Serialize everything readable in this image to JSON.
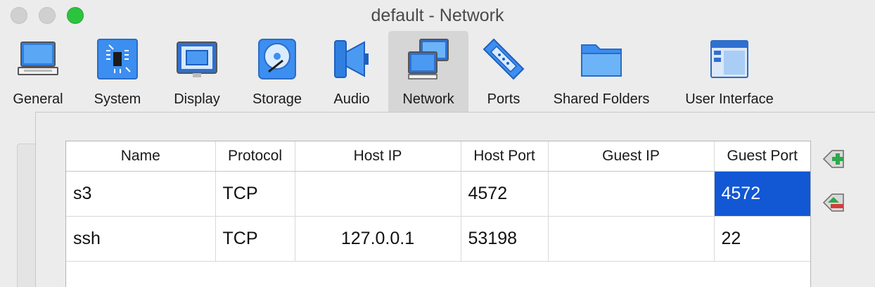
{
  "window": {
    "title": "default - Network"
  },
  "toolbar": {
    "items": [
      {
        "label": "General",
        "icon": "general-icon"
      },
      {
        "label": "System",
        "icon": "system-chip-icon"
      },
      {
        "label": "Display",
        "icon": "display-monitor-icon"
      },
      {
        "label": "Storage",
        "icon": "storage-disk-icon"
      },
      {
        "label": "Audio",
        "icon": "audio-speaker-icon"
      },
      {
        "label": "Network",
        "icon": "network-icon",
        "selected": true
      },
      {
        "label": "Ports",
        "icon": "ports-connector-icon"
      },
      {
        "label": "Shared Folders",
        "icon": "shared-folder-icon"
      },
      {
        "label": "User Interface",
        "icon": "user-interface-icon"
      }
    ]
  },
  "port_table": {
    "columns": [
      "Name",
      "Protocol",
      "Host IP",
      "Host Port",
      "Guest IP",
      "Guest Port"
    ],
    "rows": [
      [
        "s3",
        "TCP",
        "",
        "4572",
        "",
        "4572"
      ],
      [
        "ssh",
        "TCP",
        "127.0.0.1",
        "53198",
        "",
        "22"
      ]
    ],
    "selected_cell": {
      "row": 0,
      "column": 5
    }
  },
  "actions": {
    "add_rule_icon": "add-rule-icon",
    "remove_rule_icon": "remove-rule-icon"
  },
  "colors": {
    "selection": "#1257d4",
    "zoom_button": "#2cc33f",
    "selected_tab": "#d6d6d6"
  }
}
